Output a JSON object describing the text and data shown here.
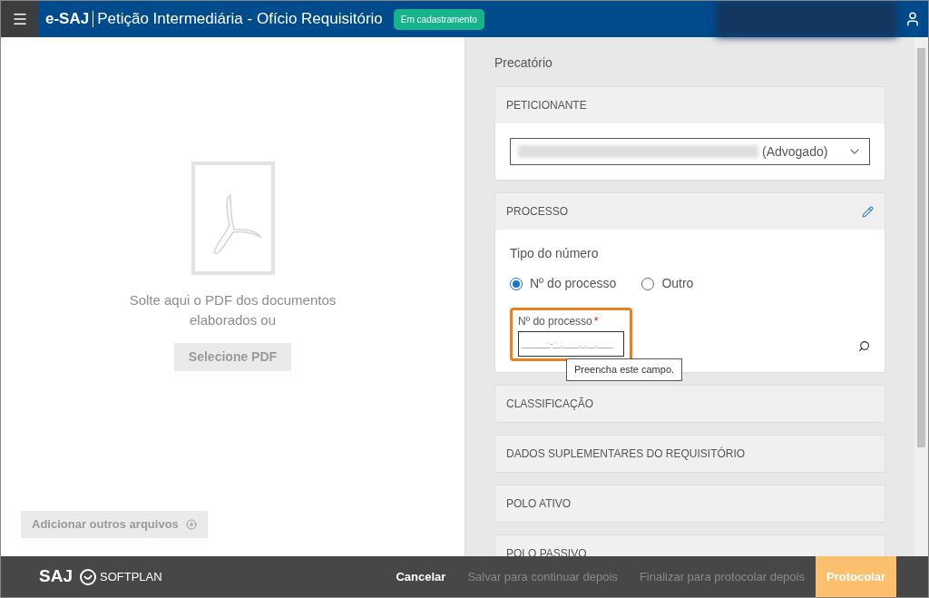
{
  "header": {
    "app": "e-SAJ",
    "title": "Petição Intermediária - Ofício Requisitório",
    "badge": "Em cadastramento"
  },
  "dropzone": {
    "message": "Solte aqui o PDF dos documentos elaborados ou",
    "select_button": "Selecione PDF",
    "add_button": "Adicionar outros arquivos"
  },
  "form": {
    "title": "Precatório",
    "sections": [
      {
        "kind": "peticionante",
        "title": "PETICIONANTE",
        "select_suffix": "(Advogado)"
      },
      {
        "kind": "processo",
        "title": "PROCESSO",
        "type_label": "Tipo do número",
        "options": [
          {
            "label": "Nº do processo",
            "selected": true
          },
          {
            "label": "Outro",
            "selected": false
          }
        ],
        "field_label": "Nº do processo",
        "required_mark": "*",
        "placeholder": "_______-__.____._.__.____",
        "tooltip": "Preencha este campo."
      },
      {
        "kind": "collapsed",
        "title": "CLASSIFICAÇÃO"
      },
      {
        "kind": "collapsed",
        "title": "DADOS SUPLEMENTARES DO REQUISITÓRIO"
      },
      {
        "kind": "collapsed",
        "title": "POLO ATIVO"
      },
      {
        "kind": "collapsed",
        "title": "POLO PASSIVO"
      }
    ]
  },
  "footer": {
    "logo": "SAJ",
    "brand": "SOFTPLAN",
    "buttons": [
      {
        "label": "Cancelar",
        "kind": "enabled"
      },
      {
        "label": "Salvar para continuar depois",
        "kind": "disabled"
      },
      {
        "label": "Finalizar para protocolar depois",
        "kind": "disabled"
      },
      {
        "label": "Protocolar",
        "kind": "primary"
      }
    ]
  }
}
